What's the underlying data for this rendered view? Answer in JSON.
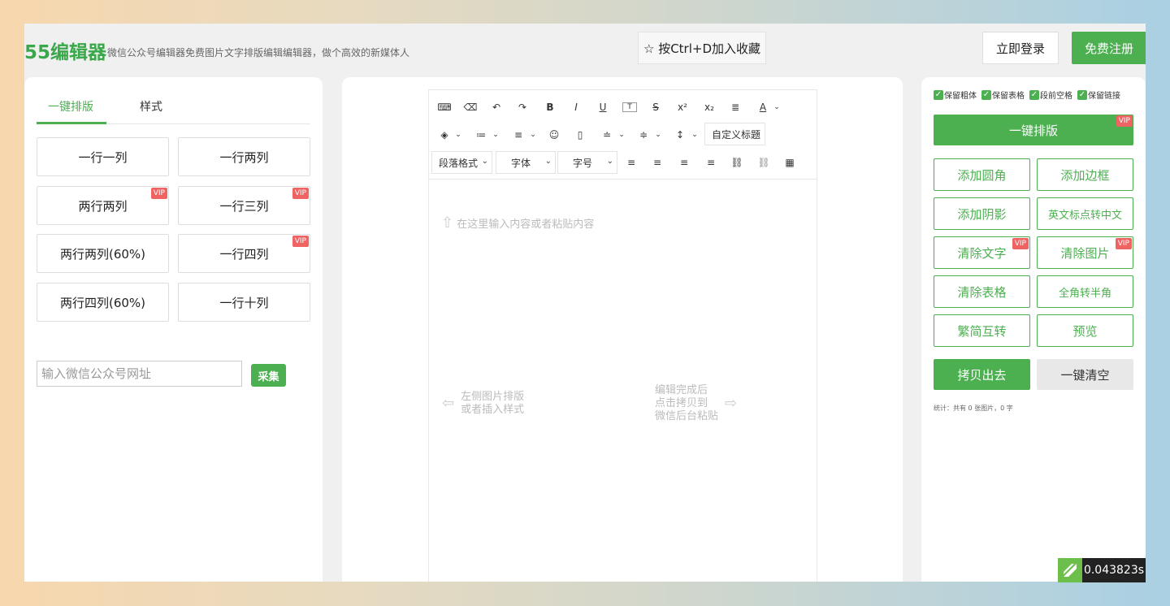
{
  "header": {
    "logo": "55编辑器",
    "slogan": "微信公众号编辑器免费图片文字排版编辑编辑器，做个高效的新媒体人",
    "favorite": "☆ 按Ctrl+D加入收藏",
    "login": "立即登录",
    "register": "免费注册"
  },
  "left": {
    "tabs": [
      "一键排版",
      "样式"
    ],
    "layouts": [
      {
        "label": "一行一列",
        "vip": ""
      },
      {
        "label": "一行两列",
        "vip": ""
      },
      {
        "label": "两行两列",
        "vip": "VIP"
      },
      {
        "label": "一行三列",
        "vip": "VIP"
      },
      {
        "label": "两行两列(60%)",
        "vip": ""
      },
      {
        "label": "一行四列",
        "vip": "VIP"
      },
      {
        "label": "两行四列(60%)",
        "vip": ""
      },
      {
        "label": "一行十列",
        "vip": ""
      }
    ],
    "url_placeholder": "输入微信公众号网址",
    "collect": "采集"
  },
  "editor": {
    "row1": [
      "⌨",
      "⌫",
      "↶",
      "↷",
      "B",
      "I",
      "U",
      "T",
      "S",
      "x²",
      "x₂",
      "≣",
      "A"
    ],
    "row2": [
      "◈",
      "≔",
      "≡",
      "☺",
      "▯",
      "≐",
      "≑",
      "↕"
    ],
    "custom_title": "自定义标题",
    "paragraph": "段落格式",
    "font": "字体",
    "size": "字号",
    "row3": [
      "≡",
      "≡",
      "≡",
      "≡",
      "⛓",
      "⛓",
      "▦"
    ],
    "hint_top": "在这里输入内容或者粘贴内容",
    "hint_left_1": "左侧图片排版",
    "hint_left_2": "或者插入样式",
    "hint_right_1": "编辑完成后",
    "hint_right_2": "点击拷贝到",
    "hint_right_3": "微信后台粘贴"
  },
  "right": {
    "options": [
      "保留粗体",
      "保留表格",
      "段前空格",
      "保留链接"
    ],
    "onekey": "一键排版",
    "onekey_vip": "VIP",
    "functions": [
      {
        "label": "添加圆角",
        "vip": ""
      },
      {
        "label": "添加边框",
        "vip": ""
      },
      {
        "label": "添加阴影",
        "vip": ""
      },
      {
        "label": "英文标点转中文",
        "vip": ""
      },
      {
        "label": "清除文字",
        "vip": "VIP"
      },
      {
        "label": "清除图片",
        "vip": "VIP"
      },
      {
        "label": "清除表格",
        "vip": ""
      },
      {
        "label": "全角转半角",
        "vip": ""
      },
      {
        "label": "繁简互转",
        "vip": ""
      },
      {
        "label": "预览",
        "vip": ""
      }
    ],
    "copy": "拷贝出去",
    "clear": "一键清空",
    "stats": "统计：共有 0 张图片，0 字"
  },
  "timer": "0.043823s",
  "colors": {
    "accent": "#4caf50",
    "vip": "#f06363"
  }
}
